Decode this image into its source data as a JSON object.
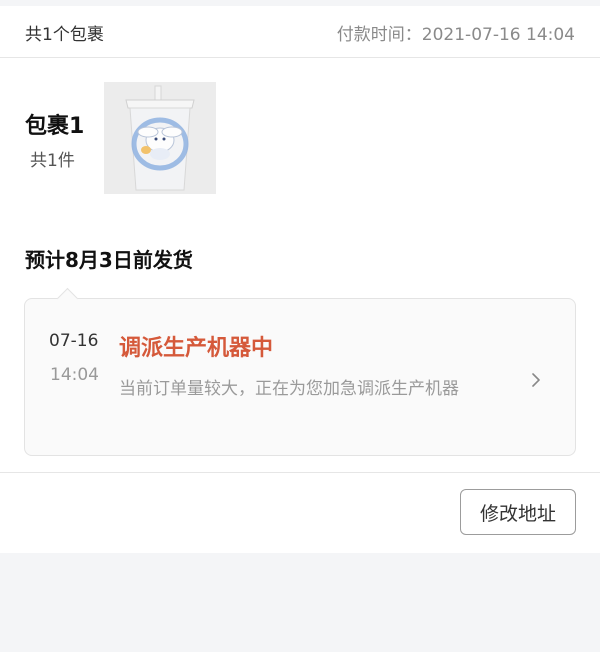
{
  "header": {
    "package_count": "共1个包裹",
    "pay_label": "付款时间：",
    "pay_time": "2021-07-16 14:04"
  },
  "package": {
    "title": "包裹1",
    "item_count": "共1件",
    "thumbnail_icon": "cup-product-image"
  },
  "shipping": {
    "estimate": "预计8月3日前发货"
  },
  "timeline": {
    "date": "07-16",
    "time": "14:04",
    "status": "调派生产机器中",
    "description": "当前订单量较大，正在为您加急调派生产机器",
    "arrow_icon": "chevron-right-icon",
    "status_color": "#d5593a"
  },
  "actions": {
    "modify_address": "修改地址"
  }
}
